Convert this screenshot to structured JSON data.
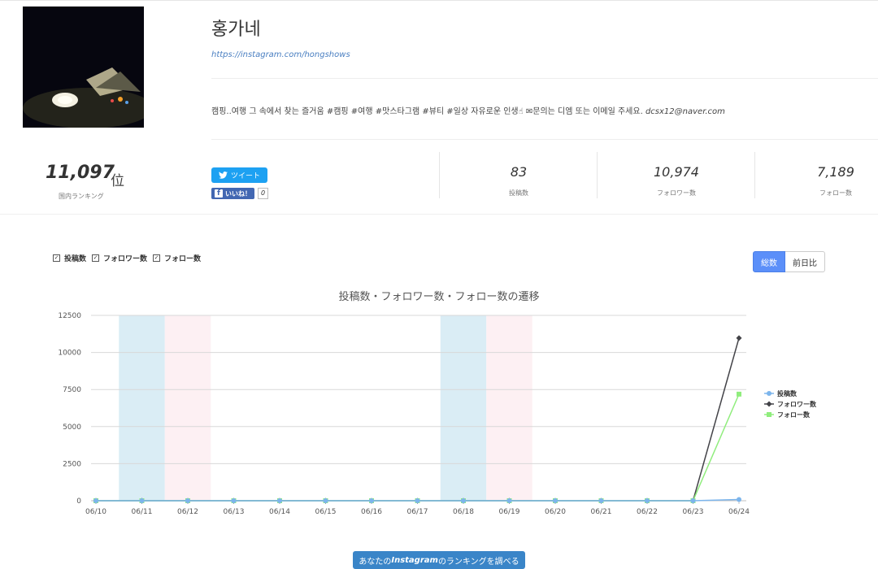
{
  "profile": {
    "name": "홍가네",
    "url": "https://instagram.com/hongshows",
    "bio": "캠핑..여행 그 속에서 찾는 즐거움 #캠핑 #여행 #맛스타그램 #뷰티 #일상 자유로운 인생☝ ✉문의는 디엠 또는 이메일 주세요.",
    "email": "dcsx12@naver.com"
  },
  "ranking": {
    "value": "11,097",
    "unit": "位",
    "label": "国内ランキング"
  },
  "share": {
    "tweet_label": "ツイート",
    "fb_label": "いいね！",
    "fb_count": "0"
  },
  "stats": [
    {
      "value": "83",
      "label": "投稿数"
    },
    {
      "value": "10,974",
      "label": "フォロワー数"
    },
    {
      "value": "7,189",
      "label": "フォロー数"
    }
  ],
  "filters": [
    {
      "label": "投稿数",
      "checked": true
    },
    {
      "label": "フォロワー数",
      "checked": true
    },
    {
      "label": "フォロー数",
      "checked": true
    }
  ],
  "toggle": {
    "total_label": "総数",
    "diff_label": "前日比"
  },
  "chart_data": {
    "type": "line",
    "title": "投稿数・フォロワー数・フォロー数の遷移",
    "categories": [
      "06/10",
      "06/11",
      "06/12",
      "06/13",
      "06/14",
      "06/15",
      "06/16",
      "06/17",
      "06/18",
      "06/19",
      "06/20",
      "06/21",
      "06/22",
      "06/23",
      "06/24"
    ],
    "ylim": [
      0,
      12500
    ],
    "yticks": [
      0,
      2500,
      5000,
      7500,
      10000,
      12500
    ],
    "weekend_bands": [
      {
        "category": "06/11",
        "color": "#daedf5"
      },
      {
        "category": "06/12",
        "color": "#fdf0f3"
      },
      {
        "category": "06/18",
        "color": "#daedf5"
      },
      {
        "category": "06/19",
        "color": "#fdf0f3"
      }
    ],
    "legend_position": "right",
    "series": [
      {
        "name": "投稿数",
        "color": "#7cb5ec",
        "marker": "circle",
        "values": [
          0,
          0,
          0,
          0,
          0,
          0,
          0,
          0,
          0,
          0,
          0,
          0,
          0,
          0,
          83
        ]
      },
      {
        "name": "フォロワー数",
        "color": "#434348",
        "marker": "diamond",
        "values": [
          0,
          0,
          0,
          0,
          0,
          0,
          0,
          0,
          0,
          0,
          0,
          0,
          0,
          0,
          10974
        ]
      },
      {
        "name": "フォロー数",
        "color": "#90ed7d",
        "marker": "square",
        "values": [
          0,
          0,
          0,
          0,
          0,
          0,
          0,
          0,
          0,
          0,
          0,
          0,
          0,
          0,
          7189
        ]
      }
    ]
  },
  "cta": {
    "prefix": "あなたの",
    "brand": "Instagram",
    "suffix": "のランキングを調べる"
  }
}
